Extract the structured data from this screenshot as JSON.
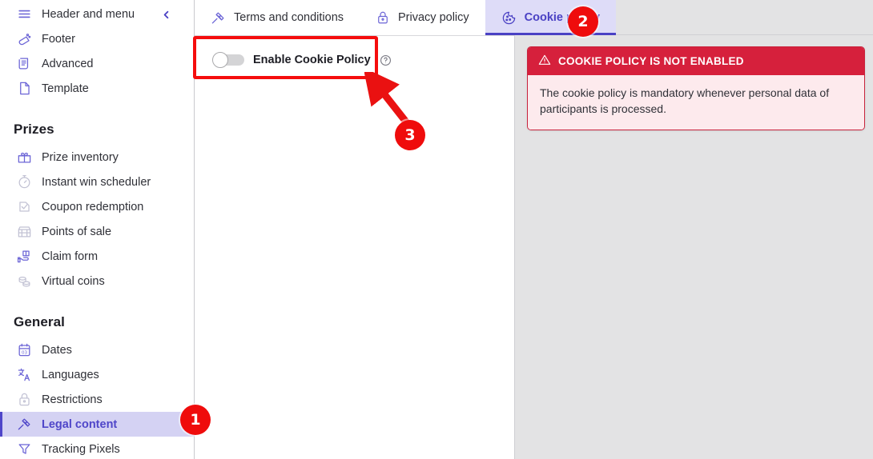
{
  "sidebar": {
    "collapse_icon": "chevron-left-icon",
    "top_items": [
      {
        "label": "Header and menu",
        "icon": "menu-lines-icon",
        "state": "normal"
      },
      {
        "label": "Footer",
        "icon": "footer-icon",
        "state": "normal"
      },
      {
        "label": "Advanced",
        "icon": "scroll-document-icon",
        "state": "normal"
      },
      {
        "label": "Template",
        "icon": "page-icon",
        "state": "normal"
      }
    ],
    "sections": [
      {
        "title": "Prizes",
        "items": [
          {
            "label": "Prize inventory",
            "icon": "gift-icon",
            "state": "normal"
          },
          {
            "label": "Instant win scheduler",
            "icon": "stopwatch-icon",
            "state": "dim"
          },
          {
            "label": "Coupon redemption",
            "icon": "coupon-icon",
            "state": "dim"
          },
          {
            "label": "Points of sale",
            "icon": "store-icon",
            "state": "dim"
          },
          {
            "label": "Claim form",
            "icon": "hand-gift-icon",
            "state": "normal"
          },
          {
            "label": "Virtual coins",
            "icon": "coins-icon",
            "state": "dim"
          }
        ]
      },
      {
        "title": "General",
        "items": [
          {
            "label": "Dates",
            "icon": "calendar-icon",
            "state": "normal"
          },
          {
            "label": "Languages",
            "icon": "translate-icon",
            "state": "normal"
          },
          {
            "label": "Restrictions",
            "icon": "lock-icon",
            "state": "dim"
          },
          {
            "label": "Legal content",
            "icon": "gavel-icon",
            "state": "active"
          },
          {
            "label": "Tracking Pixels",
            "icon": "funnel-icon",
            "state": "normal"
          }
        ]
      }
    ]
  },
  "tabs": [
    {
      "label": "Terms and conditions",
      "icon": "gavel-icon",
      "active": false
    },
    {
      "label": "Privacy policy",
      "icon": "lock-icon",
      "active": false
    },
    {
      "label": "Cookie policy",
      "icon": "cookie-icon",
      "active": true
    }
  ],
  "main": {
    "toggle": {
      "label": "Enable Cookie Policy",
      "state": "off",
      "help_icon": "question-circle-icon"
    }
  },
  "alert": {
    "icon": "warning-triangle-icon",
    "title": "COOKIE POLICY IS NOT ENABLED",
    "body": "The cookie policy is mandatory whenever personal data of participants is processed."
  },
  "annotations": {
    "badges": [
      {
        "number": "1",
        "target": "sidebar-item-legal-content"
      },
      {
        "number": "2",
        "target": "tab-cookie-policy"
      },
      {
        "number": "3",
        "target": "enable-cookie-policy-toggle"
      }
    ],
    "highlight_color": "#f50d0d"
  },
  "colors": {
    "accent": "#4f46c9",
    "accent_soft": "#d4d2f3",
    "tab_active_bg": "#dedcf8",
    "alert_red": "#d6203c",
    "alert_body_bg": "#fdeaed",
    "panel_grey": "#e3e3e4",
    "annotation_red": "#ef0c0c"
  }
}
